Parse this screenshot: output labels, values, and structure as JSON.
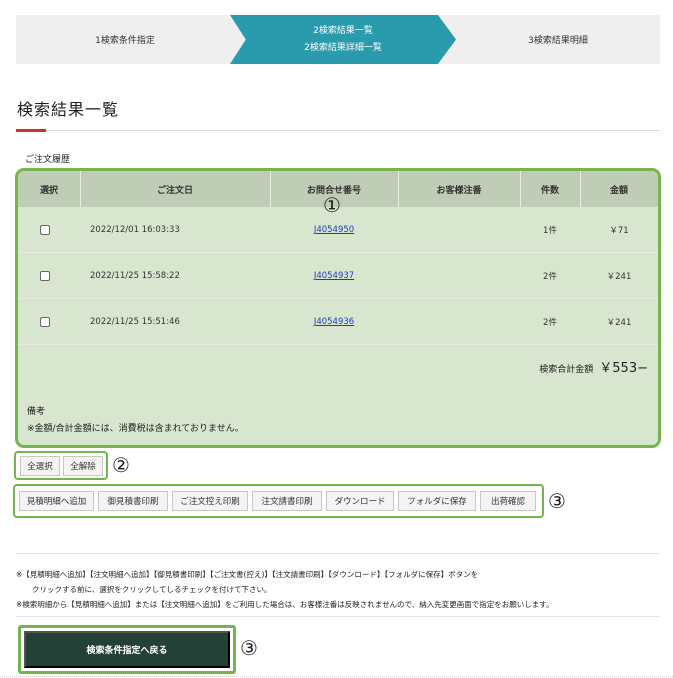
{
  "steps": {
    "step1": "1検索条件指定",
    "step2_line1": "2検索結果一覧",
    "step2_line2": "2検索結果詳細一覧",
    "step3": "3検索結果明細"
  },
  "page_title": "検索結果一覧",
  "section_label": "ご注文履歴",
  "table": {
    "headers": [
      "選択",
      "ご注文日",
      "お問合せ番号",
      "お客様注番",
      "件数",
      "金額"
    ],
    "rows": [
      {
        "date": "2022/12/01 16:03:33",
        "inquiry": "J4054950",
        "customer_no": "",
        "count": "1件",
        "amount": "￥71"
      },
      {
        "date": "2022/11/25 15:58:22",
        "inquiry": "J4054937",
        "customer_no": "",
        "count": "2件",
        "amount": "￥241"
      },
      {
        "date": "2022/11/25 15:51:46",
        "inquiry": "J4054936",
        "customer_no": "",
        "count": "2件",
        "amount": "￥241"
      }
    ],
    "total_label": "検索合計金額",
    "total_value": "￥553−"
  },
  "remarks": {
    "title": "備考",
    "text": "※金額/合計金額には、消費税は含まれておりません。"
  },
  "annotations": {
    "a1": "①",
    "a2": "②",
    "a3": "③",
    "a4": "③"
  },
  "select_buttons": {
    "select_all": "全選択",
    "deselect_all": "全解除"
  },
  "action_buttons": [
    "見積明細へ追加",
    "御見積書印刷",
    "ご注文控え印刷",
    "注文請書印刷",
    "ダウンロード",
    "フォルダに保存",
    "出荷確認"
  ],
  "notes": {
    "line1": "※【見積明細へ追加】【注文明細へ追加】【御見積書印刷】【ご注文書(控え)】【注文請書印刷】【ダウンロード】【フォルダに保存】ボタンを",
    "line2": "クリックする前に、選択をクリックしてしるチェックを付けて下さい。",
    "line3": "※検索明細から【見積明細へ追加】または【注文明細へ追加】をご利用した場合は、お客様注番は反映されませんので、納入先変更画面で指定をお願いします。"
  },
  "back_button": "検索条件指定へ戻る",
  "colors": {
    "accent_teal": "#2a9aad",
    "highlight_green": "#76b54e",
    "dark_button": "#244137",
    "title_accent": "#c0392b"
  }
}
